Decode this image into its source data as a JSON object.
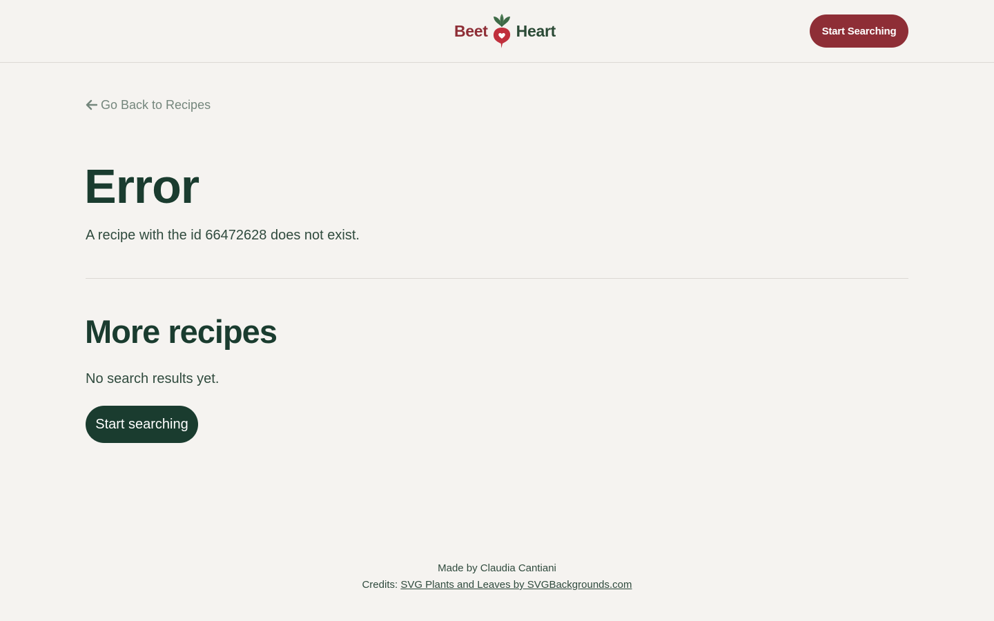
{
  "header": {
    "logo": {
      "word_left": "Beet",
      "word_right": "Heart",
      "icon": "beet-heart-icon"
    },
    "cta_label": "Start Searching"
  },
  "main": {
    "back_link": {
      "icon": "arrow-left-icon",
      "label": "Go Back to Recipes"
    },
    "error_title": "Error",
    "error_message": "A recipe with the id 66472628 does not exist.",
    "more_title": "More recipes",
    "no_results": "No search results yet.",
    "search_button": "Start searching"
  },
  "footer": {
    "made_by": "Made by Claudia Cantiani",
    "credits_prefix": "Credits:",
    "credits_link": "SVG Plants and Leaves by SVGBackgrounds.com"
  },
  "colors": {
    "background": "#f5f3f0",
    "brand_red": "#8e2e36",
    "brand_green": "#1a3c2f",
    "muted_text": "#74867c"
  }
}
